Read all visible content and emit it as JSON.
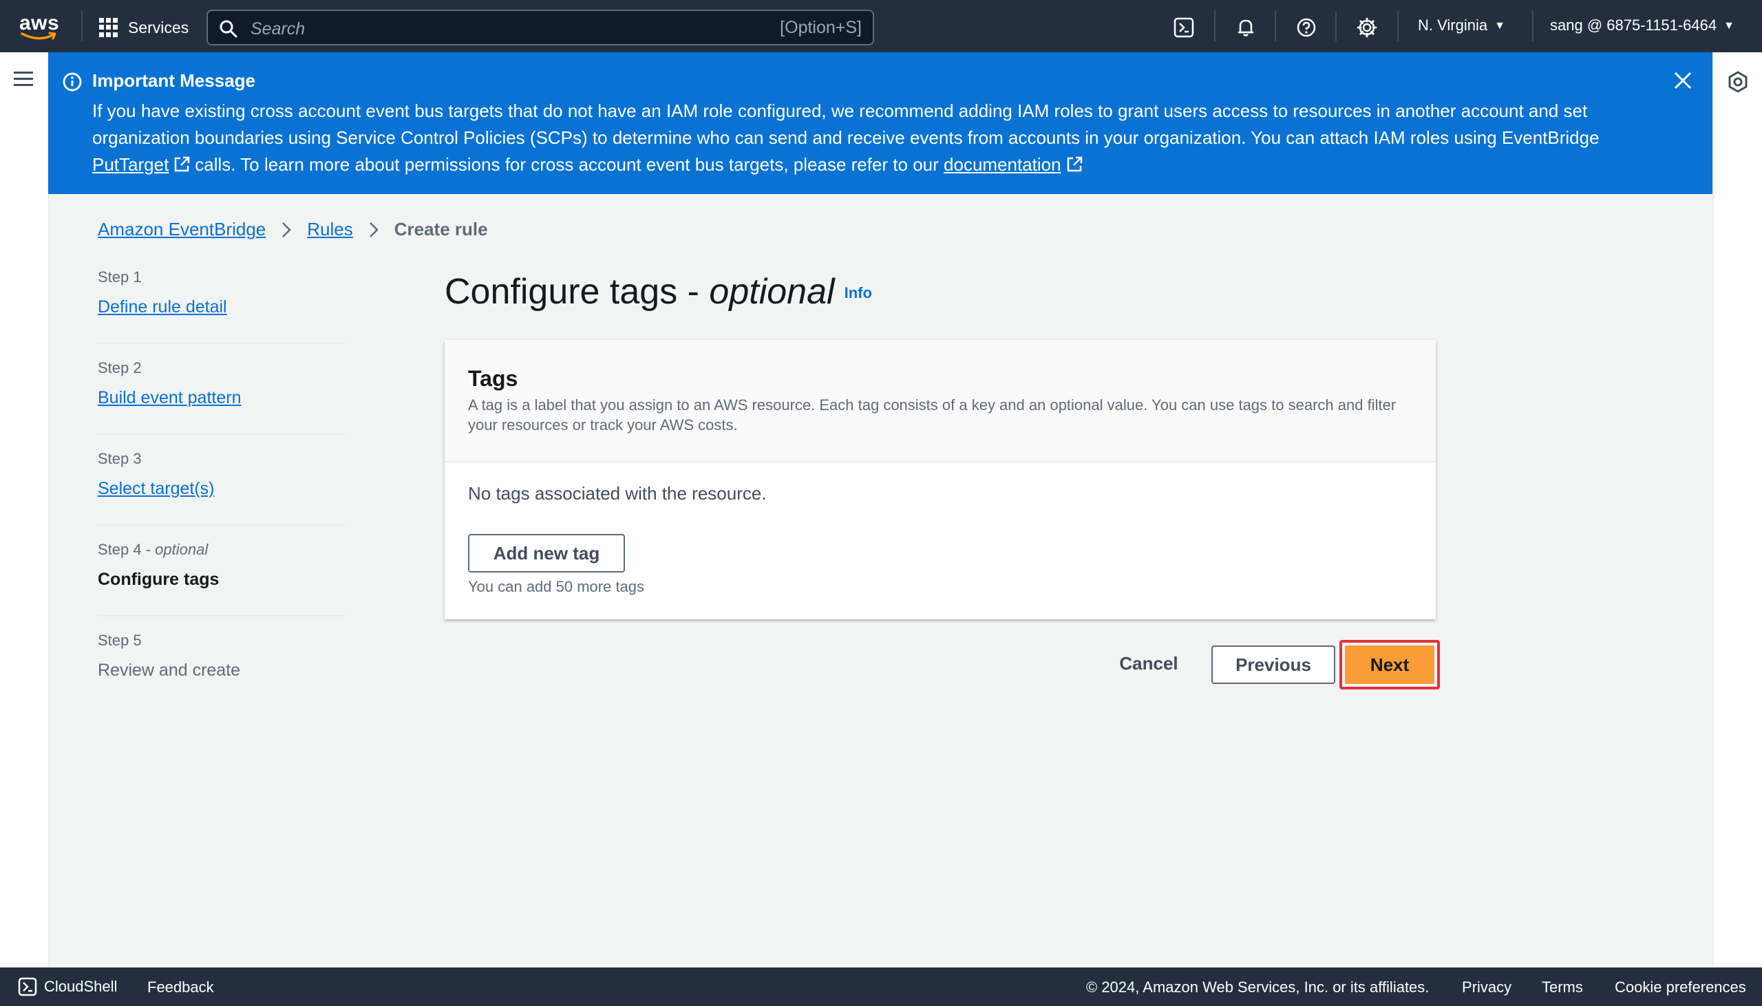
{
  "nav": {
    "logo": "aws",
    "services_label": "Services",
    "search_placeholder": "Search",
    "search_shortcut": "[Option+S]",
    "region": "N. Virginia",
    "account": "sang @ 6875-1151-6464"
  },
  "banner": {
    "title": "Important Message",
    "text_1": "If you have existing cross account event bus targets that do not have an IAM role configured, we recommend adding IAM roles to grant users access to resources in another account and set organization boundaries using Service Control Policies (SCPs) to determine who can send and receive events from accounts in your organization. You can attach IAM roles using EventBridge",
    "link_1": "PutTarget",
    "text_2": "calls. To learn more about permissions for cross account event bus targets, please refer to our",
    "link_2": "documentation"
  },
  "breadcrumb": {
    "item_1": "Amazon EventBridge",
    "item_2": "Rules",
    "current": "Create rule"
  },
  "steps": [
    {
      "num": "Step 1",
      "label": "Define rule detail"
    },
    {
      "num": "Step 2",
      "label": "Build event pattern"
    },
    {
      "num": "Step 3",
      "label": "Select target(s)"
    },
    {
      "num": "Step 4",
      "num_suffix": "optional",
      "label": "Configure tags"
    },
    {
      "num": "Step 5",
      "label": "Review and create"
    }
  ],
  "main": {
    "title": "Configure tags -",
    "title_suffix": "optional",
    "info": "Info",
    "card_title": "Tags",
    "card_desc": "A tag is a label that you assign to an AWS resource. Each tag consists of a key and an optional value. You can use tags to search and filter your resources or track your AWS costs.",
    "no_tags": "No tags associated with the resource.",
    "add_tag": "Add new tag",
    "tag_limit": "You can add 50 more tags"
  },
  "actions": {
    "cancel": "Cancel",
    "previous": "Previous",
    "next": "Next"
  },
  "footer": {
    "cloudshell": "CloudShell",
    "feedback": "Feedback",
    "copyright": "© 2024, Amazon Web Services, Inc. or its affiliates.",
    "privacy": "Privacy",
    "terms": "Terms",
    "cookies": "Cookie preferences"
  }
}
